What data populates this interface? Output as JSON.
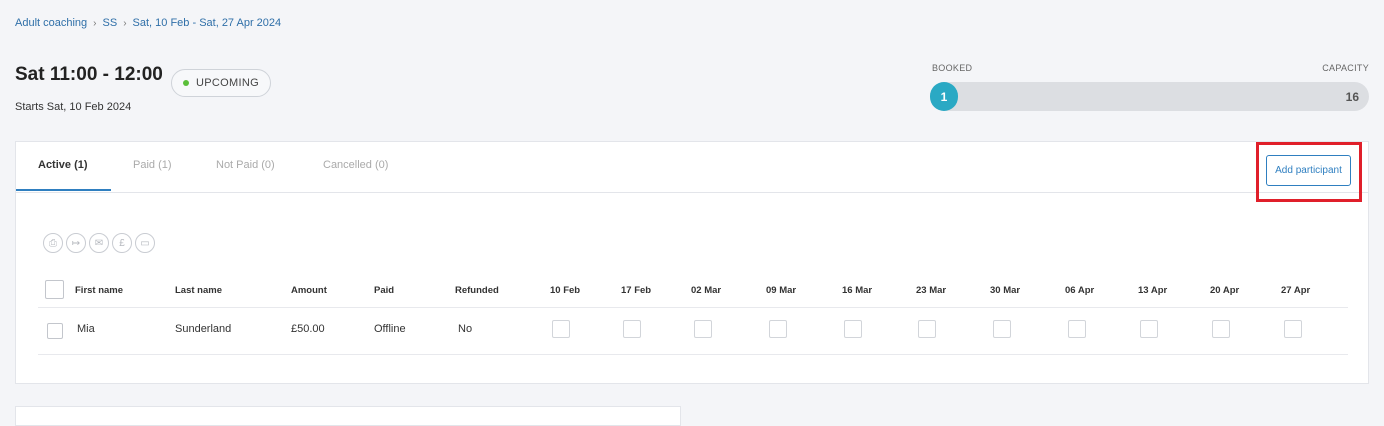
{
  "breadcrumb": [
    "Adult coaching",
    "SS",
    "Sat, 10 Feb - Sat, 27 Apr 2024"
  ],
  "breadcrumb_sep": "›",
  "session": {
    "title": "Sat 11:00 - 12:00",
    "status": "UPCOMING",
    "starts": "Starts Sat, 10 Feb 2024"
  },
  "capacity": {
    "booked_label": "BOOKED",
    "capacity_label": "CAPACITY",
    "booked": "1",
    "capacity": "16",
    "fill_fraction": 0.0625
  },
  "tabs": [
    {
      "label": "Active (1)",
      "active": true
    },
    {
      "label": "Paid (1)",
      "active": false
    },
    {
      "label": "Not Paid (0)",
      "active": false
    },
    {
      "label": "Cancelled (0)",
      "active": false
    }
  ],
  "add_participant_label": "Add participant",
  "bulk_actions": [
    {
      "icon": "print-icon",
      "glyph": "⎙"
    },
    {
      "icon": "export-icon",
      "glyph": "↦"
    },
    {
      "icon": "email-icon",
      "glyph": "✉"
    },
    {
      "icon": "pound-icon",
      "glyph": "£"
    },
    {
      "icon": "card-icon",
      "glyph": "▭"
    }
  ],
  "table": {
    "headers": {
      "first_name": "First name",
      "last_name": "Last name",
      "amount": "Amount",
      "paid": "Paid",
      "refunded": "Refunded"
    },
    "dates": [
      "10 Feb",
      "17 Feb",
      "02 Mar",
      "09 Mar",
      "16 Mar",
      "23 Mar",
      "30 Mar",
      "06 Apr",
      "13 Apr",
      "20 Apr",
      "27 Apr"
    ],
    "rows": [
      {
        "first_name": "Mia",
        "last_name": "Sunderland",
        "amount": "£50.00",
        "paid": "Offline",
        "refunded": "No"
      }
    ]
  },
  "colors": {
    "accent": "#2f7fc0",
    "status_dot": "#5bbf3a",
    "capacity_fill": "#2aa9c4",
    "highlight": "#e01f2a"
  }
}
